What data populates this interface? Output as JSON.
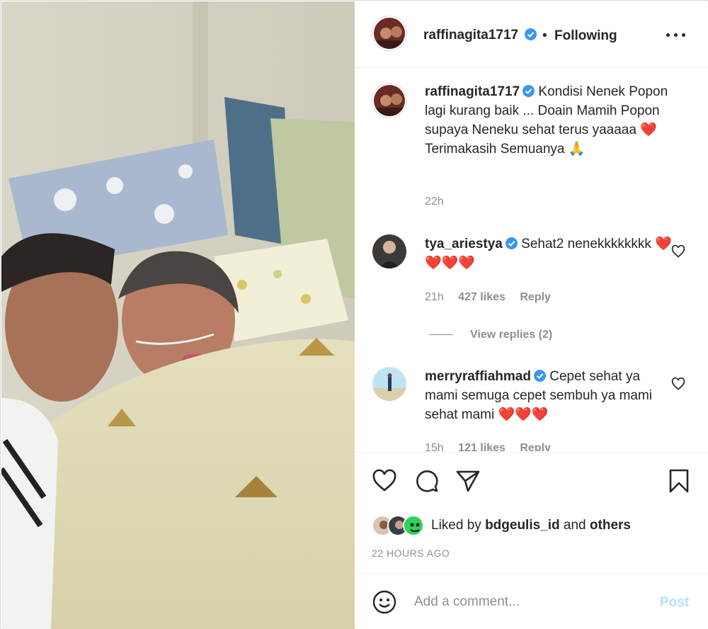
{
  "post": {
    "author": "raffinagita1717",
    "follow_status": "Following",
    "separator": "•",
    "caption_author": "raffinagita1717",
    "caption_text": "Kondisi Nenek Popon lagi kurang baik ... Doain Mamih Popon supaya Neneku sehat terus yaaaaa ❤️ Terimakasih Semuanya 🙏",
    "caption_time": "22h"
  },
  "comments": [
    {
      "username": "tya_ariestya",
      "text": "Sehat2 nenekkkkkkkk ❤️❤️❤️❤️",
      "time": "21h",
      "likes": "427 likes",
      "reply": "Reply"
    },
    {
      "username": "merryraffiahmad",
      "text": "Cepet sehat ya mami semuga cepet sembuh ya mami sehat mami ❤️❤️❤️",
      "time": "15h",
      "likes": "121 likes",
      "reply": "Reply"
    }
  ],
  "view_replies": "View replies (2)",
  "liked_by": {
    "prefix": "Liked by",
    "user": "bdgeulis_id",
    "middle": "and",
    "suffix": "others"
  },
  "timestamp": "22 HOURS AGO",
  "add_comment": {
    "placeholder": "Add a comment...",
    "post_label": "Post"
  },
  "colors": {
    "verified": "#3897f0",
    "post_disabled": "#b2dffc",
    "heart": "#ed4956"
  }
}
